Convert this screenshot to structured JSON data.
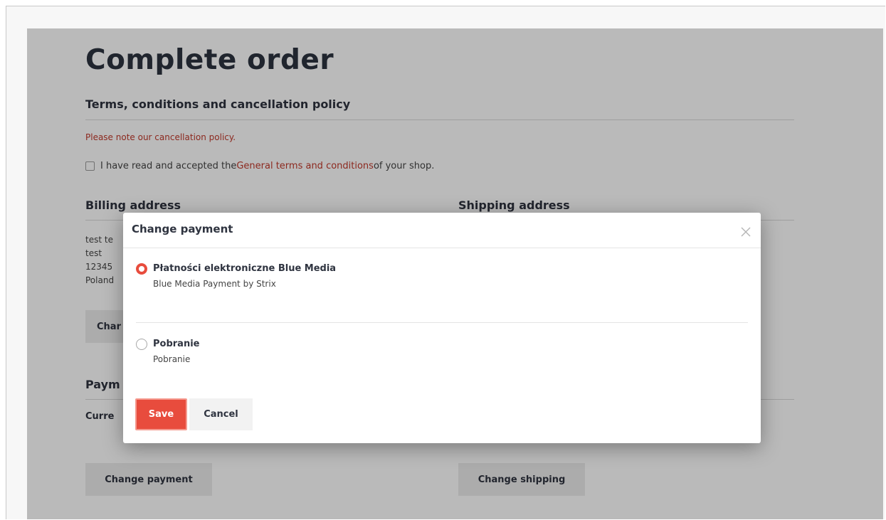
{
  "page": {
    "title": "Complete order",
    "terms_heading": "Terms, conditions and cancellation policy",
    "cancellation_note": "Please note our cancellation policy.",
    "terms_prefix": "I have read and accepted the ",
    "terms_link": "General terms and conditions",
    "terms_suffix": " of your shop.",
    "billing_heading": "Billing address",
    "shipping_heading": "Shipping address",
    "billing_lines": [
      "test te",
      "test",
      "12345",
      "Poland"
    ],
    "billing_change_label": "Char",
    "payment_heading": "Paym",
    "current_label": "Curre",
    "change_payment_label": "Change payment",
    "change_shipping_label": "Change shipping"
  },
  "modal": {
    "title": "Change payment",
    "options": [
      {
        "name": "Płatności elektroniczne Blue Media",
        "description": "Blue Media Payment by Strix",
        "selected": true
      },
      {
        "name": "Pobranie",
        "description": "Pobranie",
        "selected": false
      }
    ],
    "save_label": "Save",
    "cancel_label": "Cancel"
  },
  "colors": {
    "accent": "#e84c3d",
    "link": "#c0392b",
    "text": "#2f3440"
  },
  "icons": {
    "close": "close-icon"
  }
}
